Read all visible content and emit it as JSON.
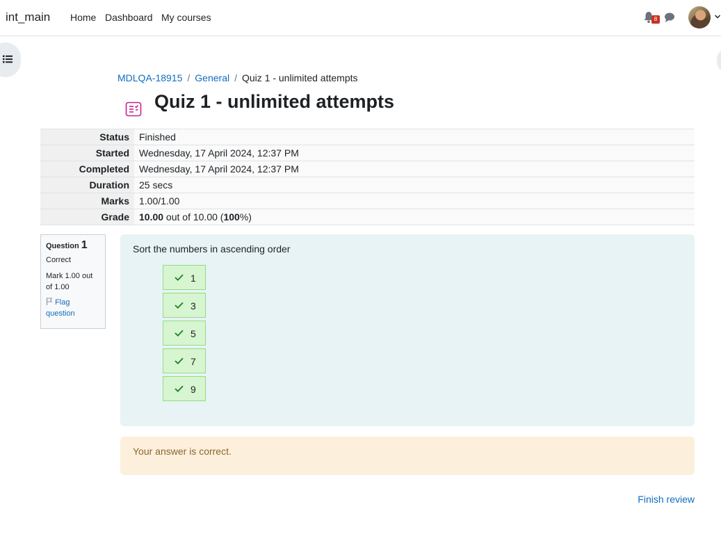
{
  "navbar": {
    "brand": "int_main",
    "links": [
      "Home",
      "Dashboard",
      "My courses"
    ],
    "notification_count": "8"
  },
  "breadcrumb": [
    "MDLQA-18915",
    "General",
    "Quiz 1 - unlimited attempts"
  ],
  "page_title": "Quiz 1 - unlimited attempts",
  "summary": [
    {
      "label": "Status",
      "value": "Finished"
    },
    {
      "label": "Started",
      "value": "Wednesday, 17 April 2024, 12:37 PM"
    },
    {
      "label": "Completed",
      "value": "Wednesday, 17 April 2024, 12:37 PM"
    },
    {
      "label": "Duration",
      "value": "25 secs"
    },
    {
      "label": "Marks",
      "value": "1.00/1.00"
    },
    {
      "label": "Grade",
      "value_bold": "10.00",
      "value_mid": " out of 10.00 (",
      "value_pct": "100",
      "value_end": "%)"
    }
  ],
  "question": {
    "label": "Question",
    "number": "1",
    "state": "Correct",
    "mark": "Mark 1.00 out of 1.00",
    "flag_label": "Flag question",
    "text": "Sort the numbers in ascending order",
    "items": [
      "1",
      "3",
      "5",
      "7",
      "9"
    ],
    "feedback": "Your answer is correct."
  },
  "finish_review": "Finish review",
  "colors": {
    "link": "#0f6cbf",
    "correct_bg": "#d7f5d0",
    "correct_border": "#93dd82",
    "question_bg": "#e7f3f5",
    "feedback_bg": "#fcefdc",
    "badge": "#ca3120"
  }
}
